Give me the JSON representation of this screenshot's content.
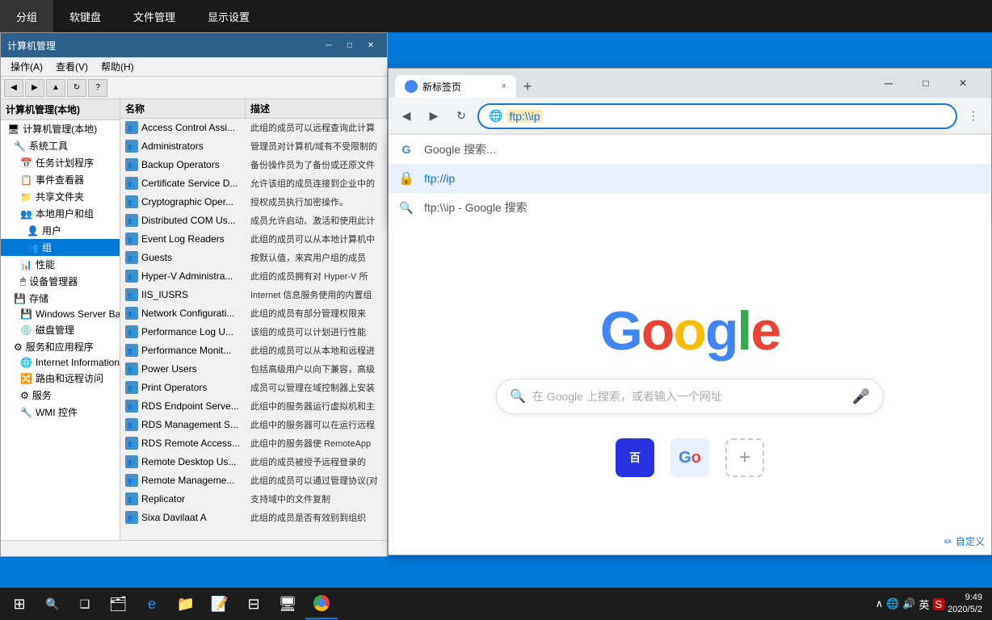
{
  "topbar": {
    "items": [
      "分组",
      "软键盘",
      "文件管理",
      "显示设置"
    ]
  },
  "comp_mgmt": {
    "title": "计算机管理",
    "title_full": "计算机管理(本地)",
    "menu": [
      "操作(A)",
      "查看(V)",
      "帮助(H)"
    ],
    "columns": {
      "name": "名称",
      "desc": "描述"
    },
    "left_tree": [
      {
        "label": "计算机管理(本地)",
        "indent": 0,
        "icon": "🖥"
      },
      {
        "label": "系统工具",
        "indent": 1,
        "icon": "🔧"
      },
      {
        "label": "任务计划程序",
        "indent": 2,
        "icon": "📅"
      },
      {
        "label": "事件查看器",
        "indent": 2,
        "icon": "📋"
      },
      {
        "label": "共享文件夹",
        "indent": 2,
        "icon": "📁"
      },
      {
        "label": "本地用户和组",
        "indent": 2,
        "icon": "👥"
      },
      {
        "label": "用户",
        "indent": 3,
        "icon": "👤"
      },
      {
        "label": "组",
        "indent": 3,
        "icon": "👥"
      },
      {
        "label": "性能",
        "indent": 2,
        "icon": "📊"
      },
      {
        "label": "设备管理器",
        "indent": 2,
        "icon": "🖱"
      },
      {
        "label": "存储",
        "indent": 1,
        "icon": "💾"
      },
      {
        "label": "Windows Server Back...",
        "indent": 2,
        "icon": "💾"
      },
      {
        "label": "磁盘管理",
        "indent": 2,
        "icon": "💿"
      },
      {
        "label": "服务和应用程序",
        "indent": 1,
        "icon": "⚙"
      },
      {
        "label": "Internet Information S...",
        "indent": 2,
        "icon": "🌐"
      },
      {
        "label": "路由和远程访问",
        "indent": 2,
        "icon": "🔀"
      },
      {
        "label": "服务",
        "indent": 2,
        "icon": "⚙"
      },
      {
        "label": "WMI 控件",
        "indent": 2,
        "icon": "🔧"
      }
    ],
    "groups": [
      {
        "name": "Access Control Assi...",
        "desc": "此组的成员可以远程查询此计算"
      },
      {
        "name": "Administrators",
        "desc": "管理员对计算机/域有不受限制的"
      },
      {
        "name": "Backup Operators",
        "desc": "备份操作员为了备份或还原文件"
      },
      {
        "name": "Certificate Service D...",
        "desc": "允许该组的成员连接到企业中的"
      },
      {
        "name": "Cryptographic Oper...",
        "desc": "授权成员执行加密操作。"
      },
      {
        "name": "Distributed COM Us...",
        "desc": "成员允许启动、激活和使用此计"
      },
      {
        "name": "Event Log Readers",
        "desc": "此组的成员可以从本地计算机中"
      },
      {
        "name": "Guests",
        "desc": "按默认值，来宾用户组的成员"
      },
      {
        "name": "Hyper-V Administra...",
        "desc": "此组的成员拥有对 Hyper-V 所"
      },
      {
        "name": "IIS_IUSRS",
        "desc": "Internet 信息服务使用的内置组"
      },
      {
        "name": "Network Configurati...",
        "desc": "此组的成员有部分管理权限来"
      },
      {
        "name": "Performance Log U...",
        "desc": "该组的成员可以计划进行性能"
      },
      {
        "name": "Performance Monit...",
        "desc": "此组的成员可以从本地和远程进"
      },
      {
        "name": "Power Users",
        "desc": "包括高级用户以向下兼容，高级"
      },
      {
        "name": "Print Operators",
        "desc": "成员可以管理在域控制器上安装"
      },
      {
        "name": "RDS Endpoint Serve...",
        "desc": "此组中的服务器运行虚拟机和主"
      },
      {
        "name": "RDS Management S...",
        "desc": "此组中的服务器可以在运行远程"
      },
      {
        "name": "RDS Remote Access...",
        "desc": "此组中的服务器使 RemoteApp"
      },
      {
        "name": "Remote Desktop Us...",
        "desc": "此组的成员被授予远程登录的"
      },
      {
        "name": "Remote Manageme...",
        "desc": "此组的成员可以通过管理协议(对"
      },
      {
        "name": "Replicator",
        "desc": "支持域中的文件复制"
      },
      {
        "name": "Sixa Davilaat A",
        "desc": "此组的成员是否有效别到组织"
      }
    ]
  },
  "chrome": {
    "tab_title": "新标签页",
    "tab_close": "×",
    "new_tab_btn": "+",
    "addr_text": "ftp:\\\\ip",
    "controls": [
      "—",
      "□",
      "×"
    ],
    "autocomplete": [
      {
        "type": "globe",
        "text": "Google 搜索...",
        "main": false,
        "url": ""
      },
      {
        "type": "lock",
        "text": "ftp://ip",
        "bold": true,
        "highlighted": true
      },
      {
        "type": "search",
        "text": "ftp:\\\\ip - Google 搜索",
        "bold": false
      }
    ],
    "google": {
      "logo_parts": [
        "G",
        "o",
        "o",
        "g",
        "l",
        "e"
      ],
      "search_placeholder": "在 Google 上搜索，或者输入一个网址",
      "footer_icons": [
        "baidu",
        "plus"
      ]
    },
    "auto_set": "自定义"
  },
  "taskbar": {
    "apps": [
      {
        "name": "start",
        "icon": "⊞"
      },
      {
        "name": "search",
        "icon": "🔍"
      },
      {
        "name": "taskview",
        "icon": "❑"
      },
      {
        "name": "explorer",
        "icon": "📁"
      },
      {
        "name": "notes",
        "icon": "📝"
      },
      {
        "name": "office",
        "icon": "⊟"
      },
      {
        "name": "computer",
        "icon": "🖥"
      },
      {
        "name": "chrome",
        "icon": "●"
      }
    ],
    "tray": {
      "lang": "英",
      "ime": "S",
      "time": "9:49",
      "date": "2020/5/2"
    }
  },
  "colors": {
    "accent": "#0078d7",
    "chrome_blue": "#1a73e8",
    "window_title": "#2c5f8a"
  }
}
